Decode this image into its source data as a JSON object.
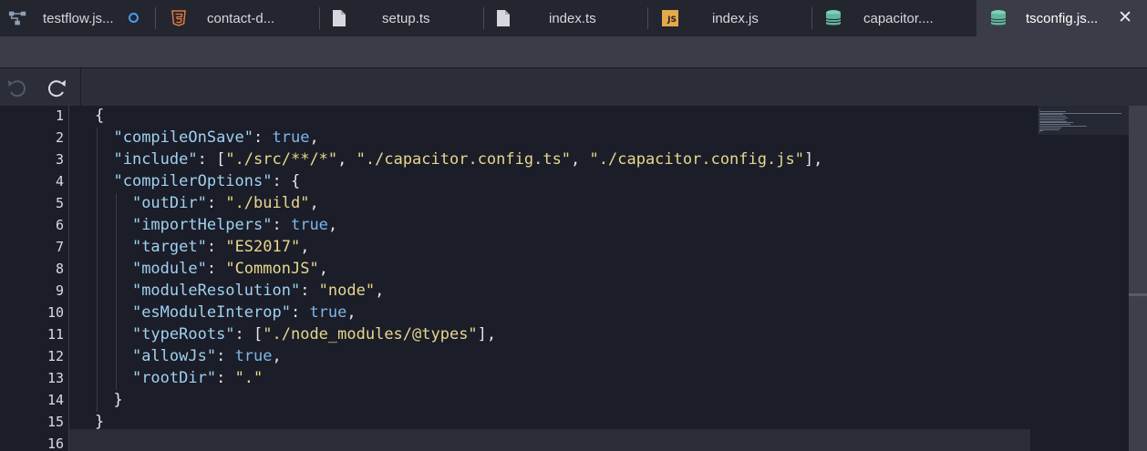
{
  "tabs": [
    {
      "label": "testflow.js...",
      "icon": "flow-icon",
      "modified": true,
      "active": false
    },
    {
      "label": "contact-d...",
      "icon": "html5-icon",
      "modified": false,
      "active": false
    },
    {
      "label": "setup.ts",
      "icon": "file-icon",
      "modified": false,
      "active": false
    },
    {
      "label": "index.ts",
      "icon": "file-icon",
      "modified": false,
      "active": false
    },
    {
      "label": "index.js",
      "icon": "js-icon",
      "icon_text": "JS",
      "modified": false,
      "active": false
    },
    {
      "label": "capacitor....",
      "icon": "database-icon",
      "modified": false,
      "active": false
    },
    {
      "label": "tsconfig.js...",
      "icon": "database-icon",
      "modified": false,
      "active": true,
      "close": "✕"
    }
  ],
  "toolbar": {
    "undo": "undo-icon",
    "redo": "redo-icon"
  },
  "editor": {
    "language": "json",
    "current_line": 16,
    "line_numbers": [
      "1",
      "2",
      "3",
      "4",
      "5",
      "6",
      "7",
      "8",
      "9",
      "10",
      "11",
      "12",
      "13",
      "14",
      "15",
      "16"
    ]
  },
  "colors": {
    "key": "#9fd1f0",
    "string": "#e7d78e",
    "boolean": "#7db7e8",
    "punct": "#e6e6e6",
    "active_tab": "#3a3c47",
    "modified_dot": "#4a9bf0"
  },
  "code": [
    [
      {
        "t": "{",
        "c": "p"
      }
    ],
    [
      {
        "t": "  ",
        "c": "p"
      },
      {
        "t": "\"compileOnSave\"",
        "c": "k"
      },
      {
        "t": ": ",
        "c": "p"
      },
      {
        "t": "true",
        "c": "b"
      },
      {
        "t": ",",
        "c": "p"
      }
    ],
    [
      {
        "t": "  ",
        "c": "p"
      },
      {
        "t": "\"include\"",
        "c": "k"
      },
      {
        "t": ": [",
        "c": "p"
      },
      {
        "t": "\"./src/**/*\"",
        "c": "s"
      },
      {
        "t": ", ",
        "c": "p"
      },
      {
        "t": "\"./capacitor.config.ts\"",
        "c": "s"
      },
      {
        "t": ", ",
        "c": "p"
      },
      {
        "t": "\"./capacitor.config.js\"",
        "c": "s"
      },
      {
        "t": "],",
        "c": "p"
      }
    ],
    [
      {
        "t": "  ",
        "c": "p"
      },
      {
        "t": "\"compilerOptions\"",
        "c": "k"
      },
      {
        "t": ": {",
        "c": "p"
      }
    ],
    [
      {
        "t": "    ",
        "c": "p"
      },
      {
        "t": "\"outDir\"",
        "c": "k"
      },
      {
        "t": ": ",
        "c": "p"
      },
      {
        "t": "\"./build\"",
        "c": "s"
      },
      {
        "t": ",",
        "c": "p"
      }
    ],
    [
      {
        "t": "    ",
        "c": "p"
      },
      {
        "t": "\"importHelpers\"",
        "c": "k"
      },
      {
        "t": ": ",
        "c": "p"
      },
      {
        "t": "true",
        "c": "b"
      },
      {
        "t": ",",
        "c": "p"
      }
    ],
    [
      {
        "t": "    ",
        "c": "p"
      },
      {
        "t": "\"target\"",
        "c": "k"
      },
      {
        "t": ": ",
        "c": "p"
      },
      {
        "t": "\"ES2017\"",
        "c": "s"
      },
      {
        "t": ",",
        "c": "p"
      }
    ],
    [
      {
        "t": "    ",
        "c": "p"
      },
      {
        "t": "\"module\"",
        "c": "k"
      },
      {
        "t": ": ",
        "c": "p"
      },
      {
        "t": "\"CommonJS\"",
        "c": "s"
      },
      {
        "t": ",",
        "c": "p"
      }
    ],
    [
      {
        "t": "    ",
        "c": "p"
      },
      {
        "t": "\"moduleResolution\"",
        "c": "k"
      },
      {
        "t": ": ",
        "c": "p"
      },
      {
        "t": "\"node\"",
        "c": "s"
      },
      {
        "t": ",",
        "c": "p"
      }
    ],
    [
      {
        "t": "    ",
        "c": "p"
      },
      {
        "t": "\"esModuleInterop\"",
        "c": "k"
      },
      {
        "t": ": ",
        "c": "p"
      },
      {
        "t": "true",
        "c": "b"
      },
      {
        "t": ",",
        "c": "p"
      }
    ],
    [
      {
        "t": "    ",
        "c": "p"
      },
      {
        "t": "\"typeRoots\"",
        "c": "k"
      },
      {
        "t": ": [",
        "c": "p"
      },
      {
        "t": "\"./node_modules/@types\"",
        "c": "s"
      },
      {
        "t": "],",
        "c": "p"
      }
    ],
    [
      {
        "t": "    ",
        "c": "p"
      },
      {
        "t": "\"allowJs\"",
        "c": "k"
      },
      {
        "t": ": ",
        "c": "p"
      },
      {
        "t": "true",
        "c": "b"
      },
      {
        "t": ",",
        "c": "p"
      }
    ],
    [
      {
        "t": "    ",
        "c": "p"
      },
      {
        "t": "\"rootDir\"",
        "c": "k"
      },
      {
        "t": ": ",
        "c": "p"
      },
      {
        "t": "\".\"",
        "c": "s"
      }
    ],
    [
      {
        "t": "  ",
        "c": "p"
      },
      {
        "t": "}",
        "c": "p"
      }
    ],
    [
      {
        "t": "}",
        "c": "p"
      }
    ],
    [
      {
        "t": "",
        "c": "p"
      }
    ]
  ]
}
